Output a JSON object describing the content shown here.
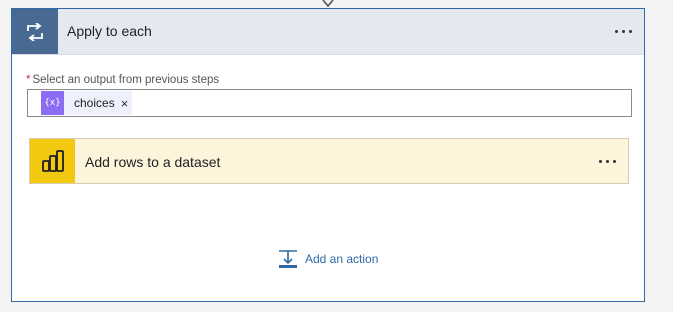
{
  "apply_card": {
    "title": "Apply to each",
    "icon": "loop-icon",
    "accent": "#486991",
    "field": {
      "required_marker": "*",
      "label": "Select an output from previous steps",
      "token": {
        "icon": "expression-icon",
        "icon_text": "{x}",
        "label": "choices",
        "remove_symbol": "×"
      }
    }
  },
  "nested_action": {
    "title": "Add rows to a dataset",
    "icon": "power-bi-icon",
    "accent": "#f2c811"
  },
  "add_action": {
    "label": "Add an action",
    "icon": "add-action-icon"
  }
}
